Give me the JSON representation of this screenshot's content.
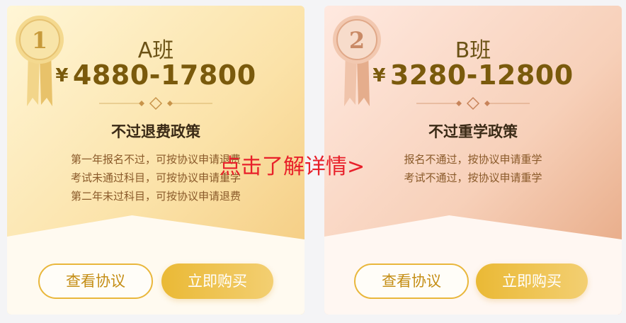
{
  "cards": [
    {
      "medal_number": "1",
      "class_name": "A班",
      "currency_symbol": "¥",
      "price_range": "4880-17800",
      "policy_title": "不过退费政策",
      "policy_lines": [
        "第一年报名不过，可按协议申请退费",
        "考试未通过科目，可按协议申请重学",
        "第二年未过科目，可按协议申请退费"
      ],
      "view_agreement_label": "查看协议",
      "buy_now_label": "立即购买"
    },
    {
      "medal_number": "2",
      "class_name": "B班",
      "currency_symbol": "¥",
      "price_range": "3280-12800",
      "policy_title": "不过重学政策",
      "policy_lines": [
        "报名不通过，按协议申请重学",
        "考试不通过，按协议申请重学"
      ],
      "view_agreement_label": "查看协议",
      "buy_now_label": "立即购买"
    }
  ],
  "overlay": {
    "details_link": "点击了解详情>"
  },
  "colors": {
    "gold_accent": "#e9b73c",
    "price_brown": "#7a5a0c",
    "overlay_red": "#e8202a"
  },
  "icons": {
    "medal_a": "gold-medal-ribbon-icon",
    "medal_b": "bronze-medal-ribbon-icon",
    "divider": "diamond-divider-icon"
  }
}
